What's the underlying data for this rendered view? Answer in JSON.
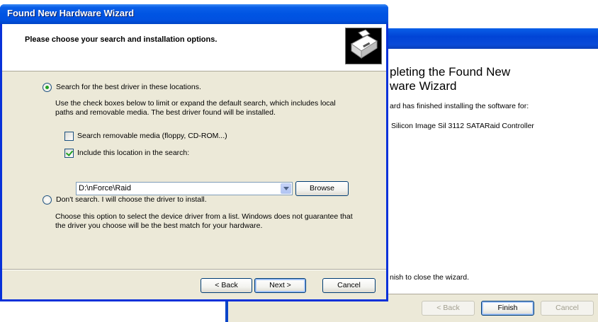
{
  "back_window": {
    "heading_line1": "pleting the Found New",
    "heading_line2": "ware Wizard",
    "finished_text": "ard has finished installing the software for:",
    "device_name": "Silicon Image Sil 3112 SATARaid Controller",
    "close_text": "nish to close the wizard.",
    "buttons": {
      "back": "< Back",
      "finish": "Finish",
      "cancel": "Cancel"
    }
  },
  "front_window": {
    "title": "Found New Hardware Wizard",
    "heading": "Please choose your search and installation options.",
    "option_search": {
      "label": "Search for the best driver in these locations.",
      "description_line1": "Use the check boxes below to limit or expand the default search, which includes local",
      "description_line2": "paths and removable media. The best driver found will be installed.",
      "selected": true
    },
    "checkbox_removable": {
      "label": "Search removable media (floppy, CD-ROM...)",
      "checked": false
    },
    "checkbox_location": {
      "label": "Include this location in the search:",
      "checked": true
    },
    "location_value": "D:\\nForce\\Raid",
    "browse_label": "Browse",
    "option_manual": {
      "label": "Don't search. I will choose the driver to install.",
      "description_line1": "Choose this option to select the device driver from a list.  Windows does not guarantee that",
      "description_line2": "the driver you choose will be the best match for your hardware.",
      "selected": false
    },
    "buttons": {
      "back": "< Back",
      "next": "Next >",
      "cancel": "Cancel"
    },
    "icons": {
      "hardware": "hardware-install-icon"
    }
  },
  "colors": {
    "titlebar": "#0054e3",
    "dialog_bg": "#ece9d8",
    "radio_dot": "#21a121"
  }
}
